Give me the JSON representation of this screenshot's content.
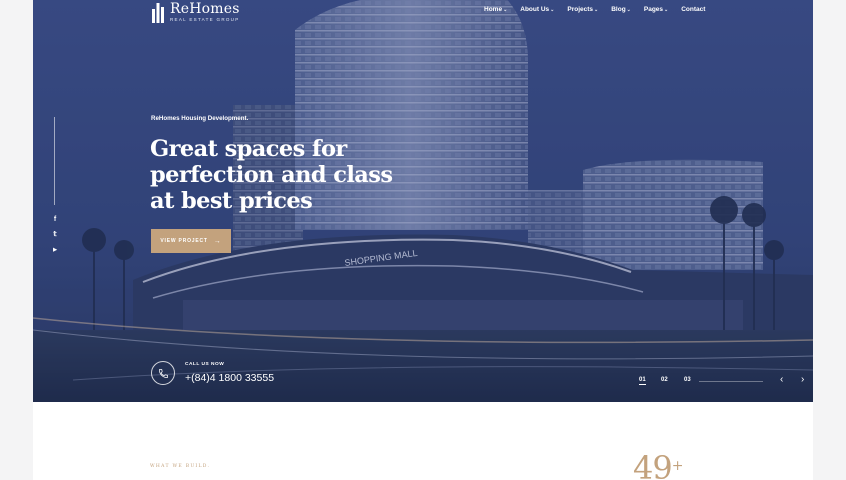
{
  "brand": {
    "name": "ReHomes",
    "tagline": "REAL ESTATE GROUP"
  },
  "nav": {
    "items": [
      {
        "label": "Home",
        "dropdown": true
      },
      {
        "label": "About Us",
        "dropdown": true
      },
      {
        "label": "Projects",
        "dropdown": true
      },
      {
        "label": "Blog",
        "dropdown": true
      },
      {
        "label": "Pages",
        "dropdown": true
      },
      {
        "label": "Contact",
        "dropdown": false
      }
    ],
    "chevron": "⌄"
  },
  "social": [
    {
      "icon": "facebook-icon",
      "glyph": "f"
    },
    {
      "icon": "twitter-icon",
      "glyph": "𝕥"
    },
    {
      "icon": "youtube-icon",
      "glyph": "▶"
    }
  ],
  "hero": {
    "kicker": "ReHomes Housing Development.",
    "headline_lines": [
      "Great spaces for",
      "perfection and class",
      "at best prices"
    ],
    "cta_label": "VIEW PROJECT",
    "cta_arrow": "→",
    "call_label": "CALL US NOW",
    "phone": "+(84)4 1800 33555",
    "signage": "SHOPPING MALL"
  },
  "slider": {
    "pages": [
      "01",
      "02",
      "03"
    ],
    "active_index": 0,
    "prev_glyph": "‹",
    "next_glyph": "›"
  },
  "intro": {
    "section_tag": "WHAT WE BUILD.",
    "stat_value": "49",
    "stat_suffix": "+"
  },
  "colors": {
    "accent": "#c3a27d",
    "hero_tint": "#34487e",
    "page_bg": "#f4f4f5"
  }
}
